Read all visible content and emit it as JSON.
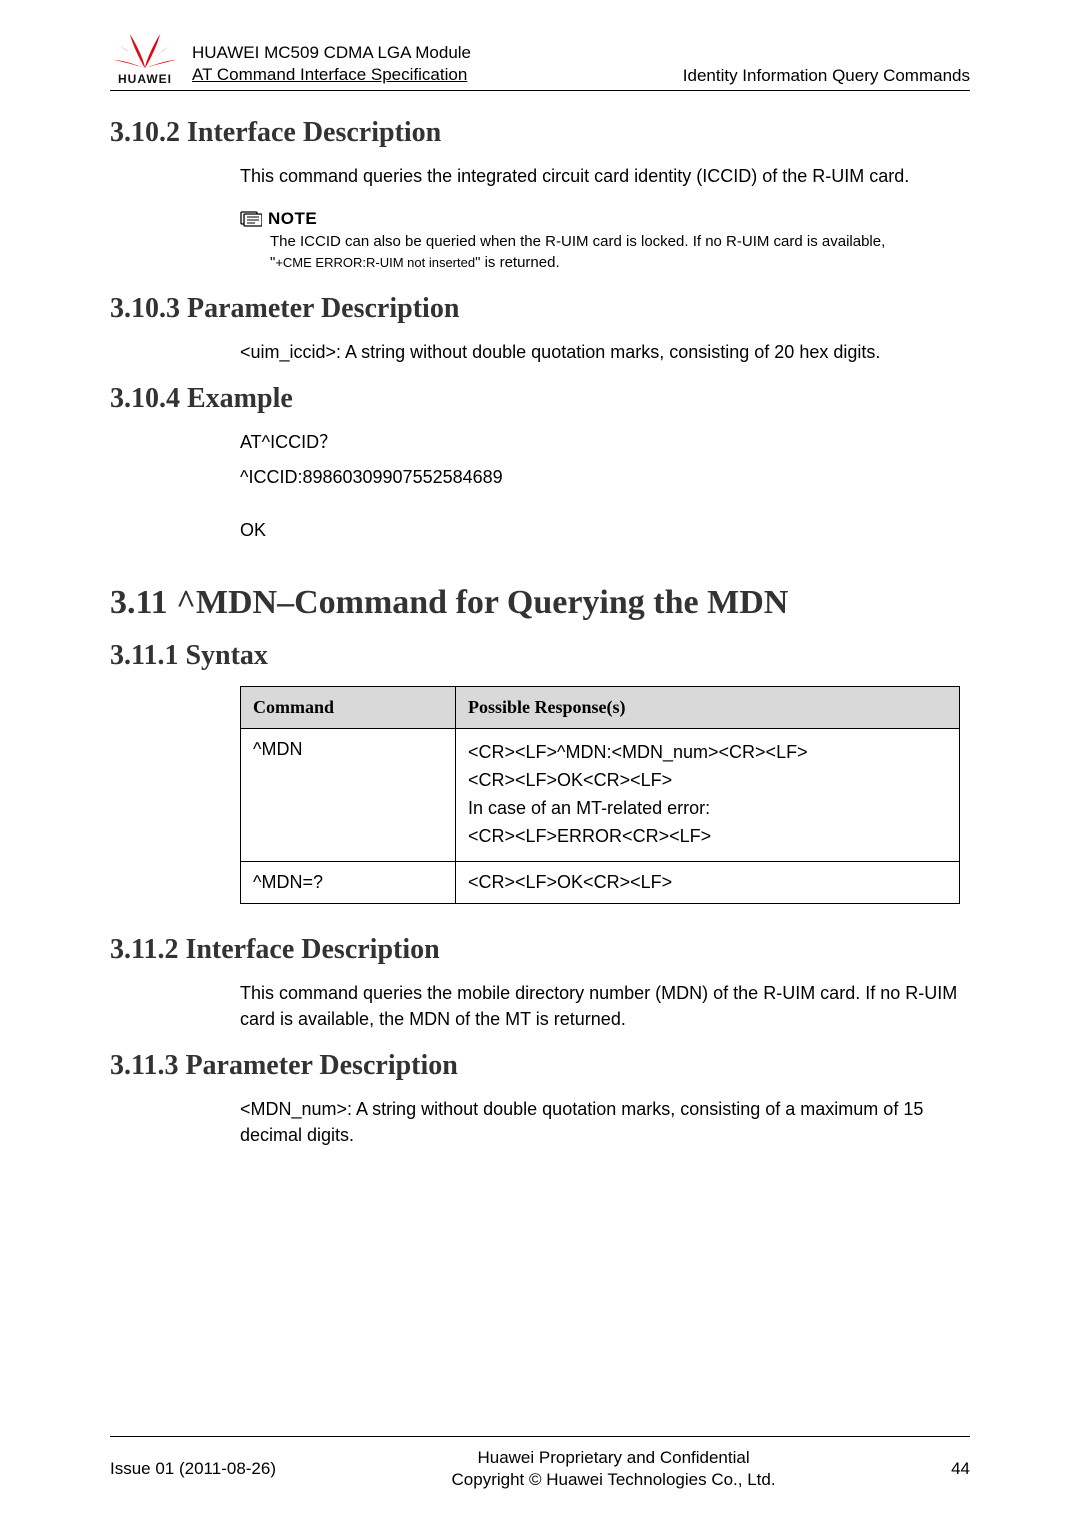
{
  "header": {
    "logo_text": "HUAWEI",
    "title_line1": "HUAWEI MC509 CDMA LGA Module",
    "title_line2": "AT Command Interface Specification",
    "right": "Identity Information Query Commands"
  },
  "sections": {
    "s3102": {
      "heading": "3.10.2 Interface Description",
      "para": "This command queries the integrated circuit card identity (ICCID) of the R-UIM card."
    },
    "note": {
      "label": "NOTE",
      "line_a": "The ICCID can also be queried when the R-UIM card is locked. If no R-UIM card is available,",
      "line_b_prefix": "\"",
      "line_b_mono": "+CME ERROR:R-UIM not inserted",
      "line_b_suffix": "\" is returned."
    },
    "s3103": {
      "heading": "3.10.3 Parameter Description",
      "para": "<uim_iccid>: A string without double quotation marks, consisting of 20 hex digits."
    },
    "s3104": {
      "heading": "3.10.4 Example",
      "line1": "AT^ICCID？",
      "line2": "^ICCID:89860309907552584689",
      "line3": "OK"
    },
    "s311": {
      "heading": "3.11 ^MDN–Command for Querying the MDN"
    },
    "s3111": {
      "heading": "3.11.1 Syntax",
      "table": {
        "head_col1": "Command",
        "head_col2": "Possible Response(s)",
        "row1_cmd": "^MDN",
        "row1_resp1": "<CR><LF>^MDN:<MDN_num><CR><LF>",
        "row1_resp2": "<CR><LF>OK<CR><LF>",
        "row1_resp3": "In case of an MT-related error:",
        "row1_resp4": "<CR><LF>ERROR<CR><LF>",
        "row2_cmd": "^MDN=?",
        "row2_resp": "<CR><LF>OK<CR><LF>"
      }
    },
    "s3112": {
      "heading": "3.11.2 Interface Description",
      "para": "This command queries the mobile directory number (MDN) of the R-UIM card. If no R-UIM card is available, the MDN of the MT is returned."
    },
    "s3113": {
      "heading": "3.11.3 Parameter Description",
      "para": "<MDN_num>: A string without double quotation marks, consisting of a maximum of 15 decimal digits."
    }
  },
  "footer": {
    "issue": "Issue 01 (2011-08-26)",
    "center1": "Huawei Proprietary and Confidential",
    "center2": "Copyright © Huawei Technologies Co., Ltd.",
    "page": "44"
  }
}
